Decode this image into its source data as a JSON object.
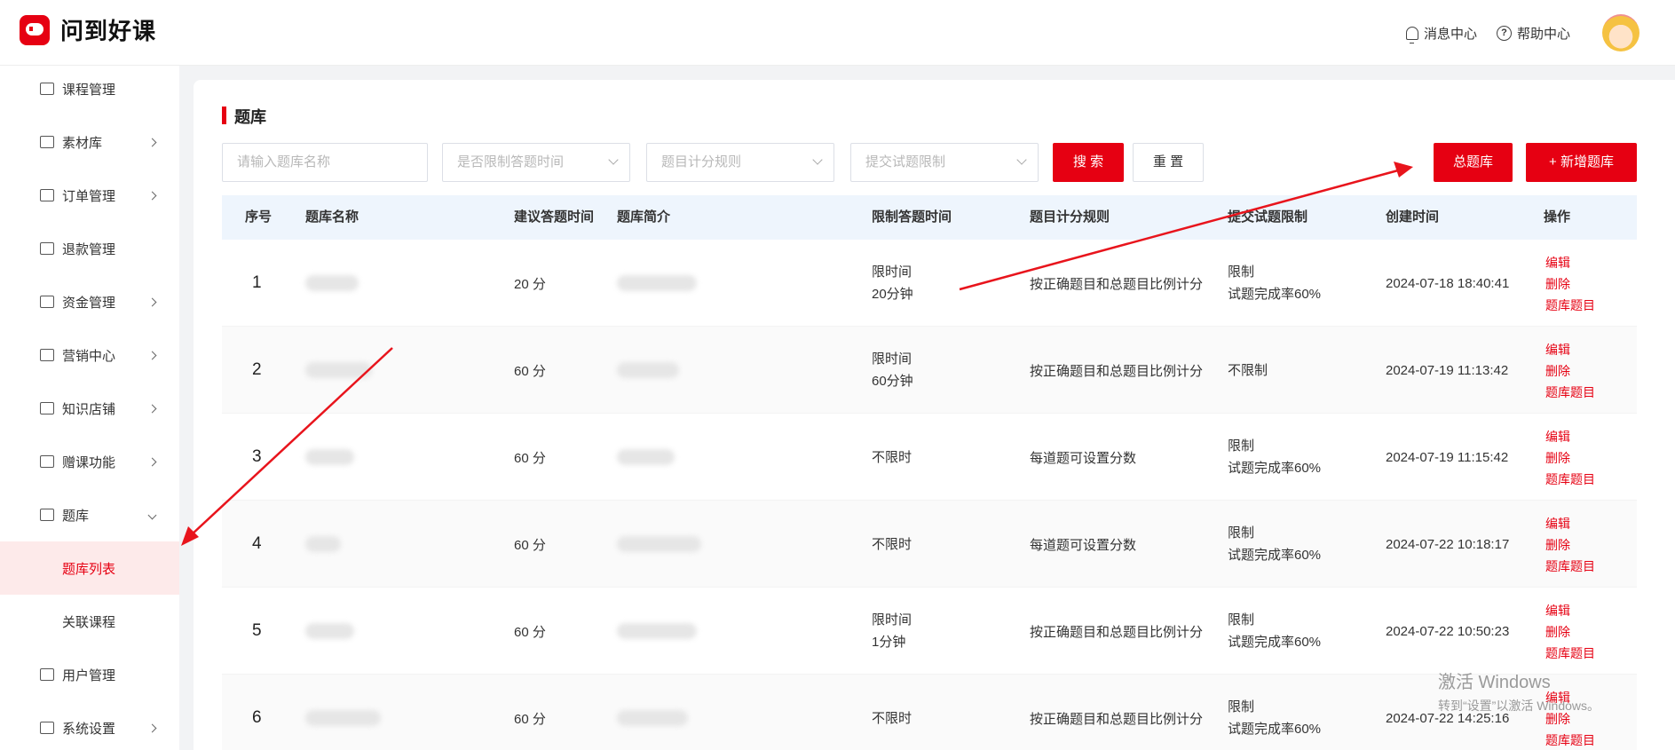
{
  "app": {
    "name": "问到好课"
  },
  "header": {
    "messages": "消息中心",
    "help": "帮助中心"
  },
  "sidebar": {
    "items": [
      {
        "label": "课程管理",
        "icon": "course-icon",
        "arrow": false
      },
      {
        "label": "素材库",
        "icon": "folder-icon",
        "arrow": true
      },
      {
        "label": "订单管理",
        "icon": "order-icon",
        "arrow": true
      },
      {
        "label": "退款管理",
        "icon": "refund-icon",
        "arrow": false
      },
      {
        "label": "资金管理",
        "icon": "wallet-icon",
        "arrow": true
      },
      {
        "label": "营销中心",
        "icon": "gift-icon",
        "arrow": true
      },
      {
        "label": "知识店铺",
        "icon": "shop-icon",
        "arrow": true
      },
      {
        "label": "赠课功能",
        "icon": "gift-course-icon",
        "arrow": true
      },
      {
        "label": "题库",
        "icon": "question-bank-icon",
        "arrow": true,
        "expanded": true
      },
      {
        "label": "题库列表",
        "sub": true,
        "active": true
      },
      {
        "label": "关联课程",
        "sub": true
      },
      {
        "label": "用户管理",
        "icon": "user-icon",
        "arrow": false
      },
      {
        "label": "系统设置",
        "icon": "settings-icon",
        "arrow": true
      }
    ]
  },
  "page": {
    "title": "题库"
  },
  "filters": {
    "name_placeholder": "请输入题库名称",
    "time_limit_placeholder": "是否限制答题时间",
    "scoring_placeholder": "题目计分规则",
    "submit_limit_placeholder": "提交试题限制",
    "search_label": "搜 索",
    "reset_label": "重 置",
    "total_bank_label": "总题库",
    "add_bank_label": "+ 新增题库"
  },
  "table": {
    "headers": [
      "序号",
      "题库名称",
      "建议答题时间",
      "题库简介",
      "限制答题时间",
      "题目计分规则",
      "提交试题限制",
      "创建时间",
      "操作"
    ],
    "rows": [
      {
        "no": "1",
        "time": "20 分",
        "limit1": "限时间",
        "limit2": "20分钟",
        "rule": "按正确题目和总题目比例计分",
        "submit1": "限制",
        "submit2": "试题完成率60%",
        "created": "2024-07-18 18:40:41"
      },
      {
        "no": "2",
        "time": "60 分",
        "limit1": "限时间",
        "limit2": "60分钟",
        "rule": "按正确题目和总题目比例计分",
        "submit1": "不限制",
        "submit2": "",
        "created": "2024-07-19 11:13:42"
      },
      {
        "no": "3",
        "time": "60 分",
        "limit1": "不限时",
        "limit2": "",
        "rule": "每道题可设置分数",
        "submit1": "限制",
        "submit2": "试题完成率60%",
        "created": "2024-07-19 11:15:42"
      },
      {
        "no": "4",
        "time": "60 分",
        "limit1": "不限时",
        "limit2": "",
        "rule": "每道题可设置分数",
        "submit1": "限制",
        "submit2": "试题完成率60%",
        "created": "2024-07-22 10:18:17"
      },
      {
        "no": "5",
        "time": "60 分",
        "limit1": "限时间",
        "limit2": "1分钟",
        "rule": "按正确题目和总题目比例计分",
        "submit1": "限制",
        "submit2": "试题完成率60%",
        "created": "2024-07-22 10:50:23"
      },
      {
        "no": "6",
        "time": "60 分",
        "limit1": "不限时",
        "limit2": "",
        "rule": "按正确题目和总题目比例计分",
        "submit1": "限制",
        "submit2": "试题完成率60%",
        "created": "2024-07-22 14:25:16"
      }
    ],
    "ops": {
      "edit": "编辑",
      "delete": "删除",
      "questions": "题库题目"
    }
  },
  "watermark": {
    "line1": "激活 Windows",
    "line2": "转到“设置”以激活 Windows。"
  },
  "colors": {
    "accent": "#e60012",
    "header_bg": "#eef5fd"
  }
}
